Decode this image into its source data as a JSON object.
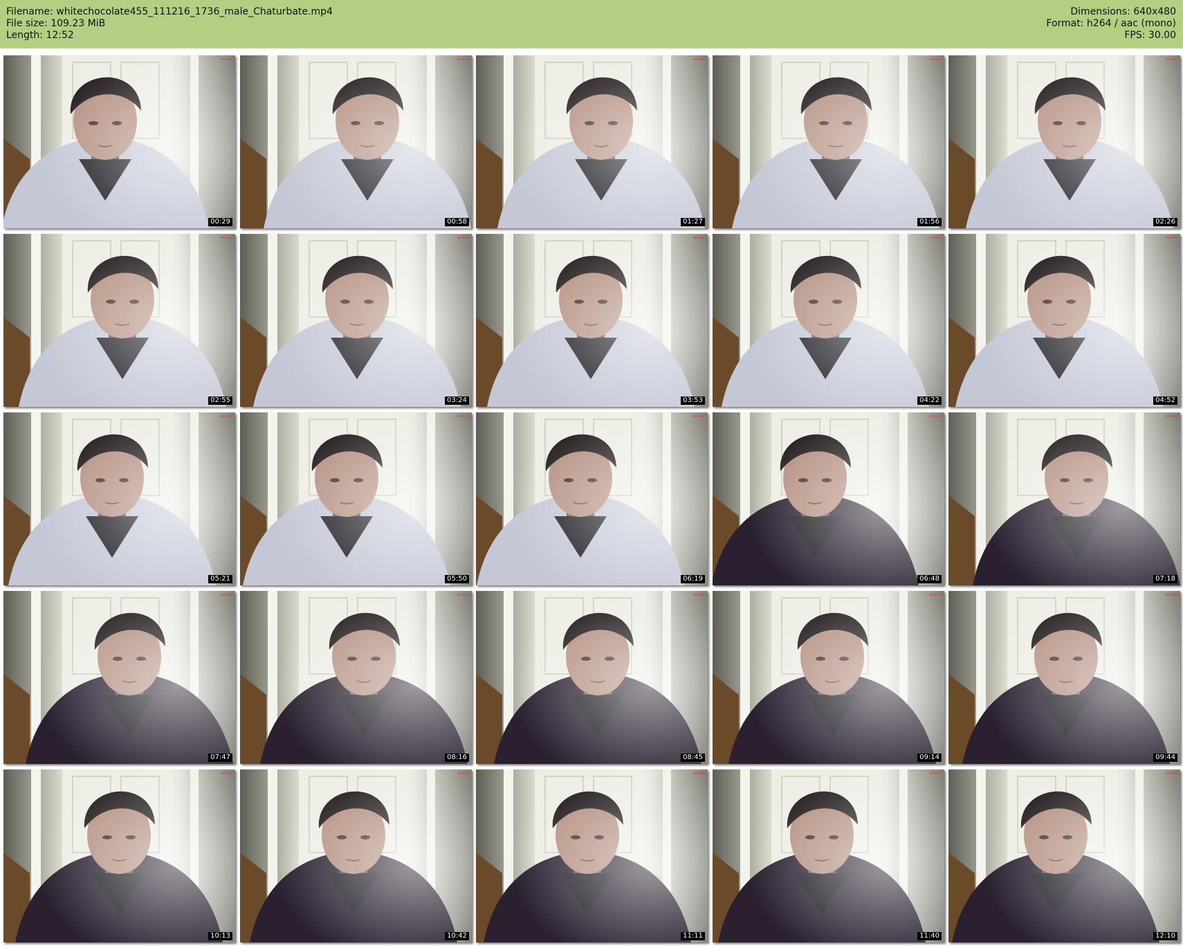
{
  "header": {
    "filename_line": "Filename: whitechocolate455_111216_1736_male_Chaturbate.mp4",
    "filesize_line": "File size: 109.23 MiB",
    "length_line": "Length: 12:52",
    "dimensions_line": "Dimensions: 640x480",
    "format_line": "Format: h264 / aac (mono)",
    "fps_line": "FPS: 30.00",
    "background_color": "#b3cf82"
  },
  "thumbnails": [
    {
      "timestamp": "00:29",
      "outfit": "hoodie"
    },
    {
      "timestamp": "00:58",
      "outfit": "hoodie"
    },
    {
      "timestamp": "01:27",
      "outfit": "hoodie"
    },
    {
      "timestamp": "01:56",
      "outfit": "hoodie"
    },
    {
      "timestamp": "02:26",
      "outfit": "hoodie"
    },
    {
      "timestamp": "02:55",
      "outfit": "hoodie"
    },
    {
      "timestamp": "03:24",
      "outfit": "hoodie"
    },
    {
      "timestamp": "03:53",
      "outfit": "hoodie"
    },
    {
      "timestamp": "04:22",
      "outfit": "hoodie"
    },
    {
      "timestamp": "04:52",
      "outfit": "hoodie"
    },
    {
      "timestamp": "05:21",
      "outfit": "hoodie"
    },
    {
      "timestamp": "05:50",
      "outfit": "hoodie"
    },
    {
      "timestamp": "06:19",
      "outfit": "hoodie"
    },
    {
      "timestamp": "06:48",
      "outfit": "dark-sweater"
    },
    {
      "timestamp": "07:18",
      "outfit": "dark-sweater"
    },
    {
      "timestamp": "07:47",
      "outfit": "dark-sweater"
    },
    {
      "timestamp": "08:16",
      "outfit": "dark-sweater"
    },
    {
      "timestamp": "08:45",
      "outfit": "dark-sweater"
    },
    {
      "timestamp": "09:14",
      "outfit": "dark-sweater"
    },
    {
      "timestamp": "09:44",
      "outfit": "dark-sweater"
    },
    {
      "timestamp": "10:13",
      "outfit": "dark-sweater"
    },
    {
      "timestamp": "10:42",
      "outfit": "dark-sweater"
    },
    {
      "timestamp": "11:11",
      "outfit": "dark-sweater"
    },
    {
      "timestamp": "11:40",
      "outfit": "dark-sweater"
    },
    {
      "timestamp": "12:10",
      "outfit": "dark-sweater"
    }
  ],
  "colors": {
    "hoodie": "#c4c8d6",
    "dark_sweater": "#2a2030",
    "hair": "#221a1c",
    "skin": "#b48f80",
    "wall": "#d8d8cc",
    "door": "#eeeee6",
    "wood": "#6b4a2a",
    "timestamp_bg": "#000000"
  }
}
